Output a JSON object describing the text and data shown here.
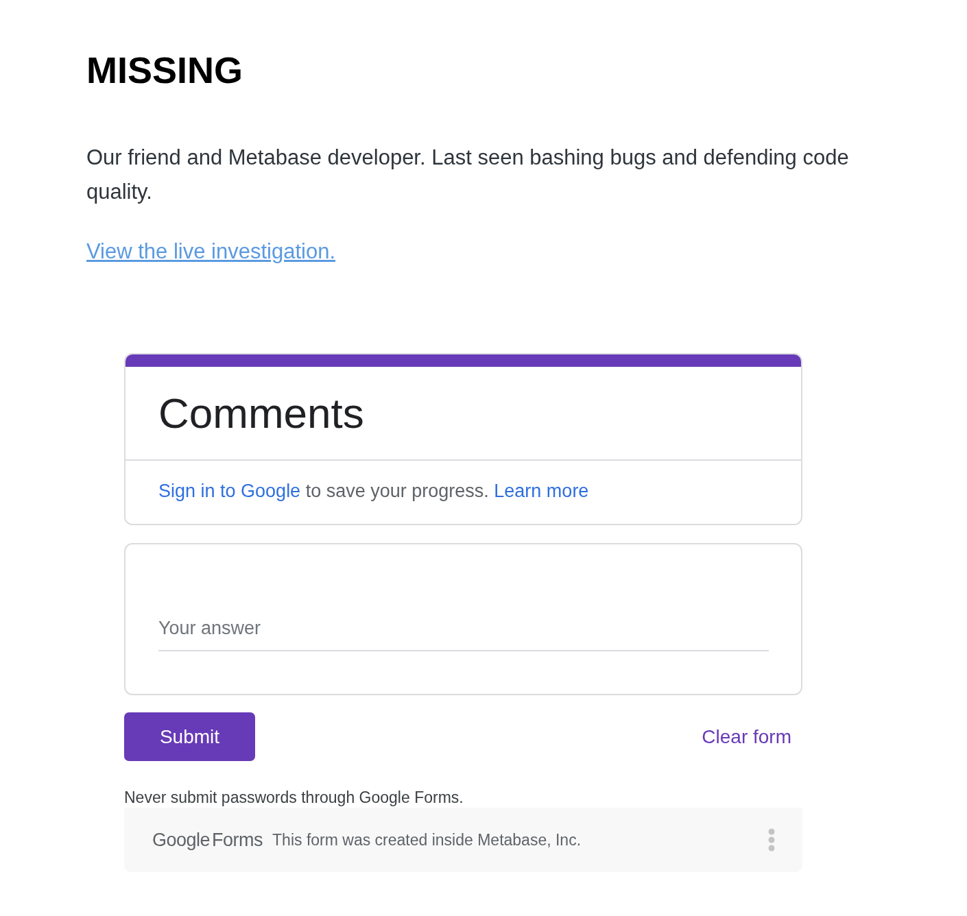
{
  "heading": "MISSING",
  "description": "Our friend and Metabase developer. Last seen bashing bugs and defending code quality.",
  "investigation_link": "View the live investigation.",
  "form": {
    "title": "Comments",
    "sign_in_notice": [
      {
        "kind": "link",
        "text": "Sign in to Google"
      },
      {
        "kind": "text",
        "text": "to save your progress."
      },
      {
        "kind": "link",
        "text": "Learn more"
      }
    ],
    "answer_field": {
      "placeholder": "Your answer"
    },
    "buttons": {
      "submit": "Submit",
      "clear": "Clear form"
    },
    "password_warning": "Never submit passwords through Google Forms.",
    "footer": {
      "logo": "Google Forms",
      "note": "This form was created inside Metabase, Inc."
    }
  }
}
